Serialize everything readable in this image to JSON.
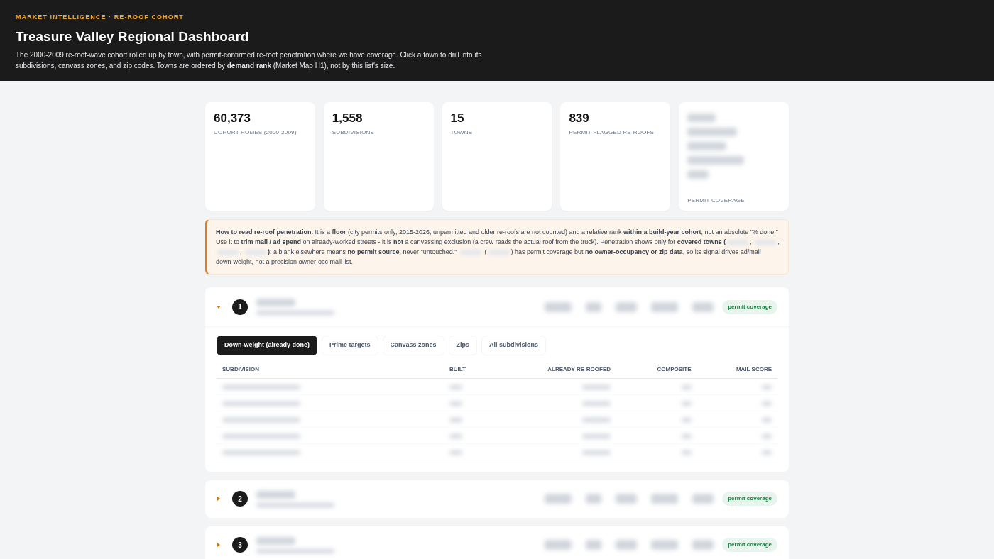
{
  "header": {
    "eyebrow": "MARKET INTELLIGENCE · RE-ROOF COHORT",
    "title": "Treasure Valley Regional Dashboard",
    "description": "The 2000-2009 re-roof-wave cohort rolled up by town, with permit-confirmed re-roof penetration where we have coverage. Click a town to drill into its subdivisions, canvass zones, and zip codes. Towns are ordered by **demand rank** (Market Map H1), not by this list's size."
  },
  "stats": [
    {
      "kind": "value",
      "value": "60,373",
      "label": "COHORT HOMES (2000-2009)"
    },
    {
      "kind": "value",
      "value": "1,558",
      "label": "SUBDIVISIONS"
    },
    {
      "kind": "value",
      "value": "15",
      "label": "TOWNS"
    },
    {
      "kind": "value",
      "value": "839",
      "label": "PERMIT-FLAGGED RE-ROOFS"
    },
    {
      "kind": "redacted",
      "label": "PERMIT COVERAGE"
    }
  ],
  "callout": {
    "parts": [
      {
        "kind": "text",
        "text": "**How to read re-roof penetration.** It is a **floor** (city permits only, 2015-2026; unpermitted and older re-roofs are not counted) and a relative rank **within a build-year cohort**, not an absolute \"% done.\" Use it to **trim mail / ad spend** on already-worked streets - it is **not** a canvassing exclusion (a crew reads the actual roof from the truck). Penetration shows only for **covered towns (**"
      },
      {
        "kind": "redacted"
      },
      {
        "kind": "text",
        "text": ", "
      },
      {
        "kind": "redacted"
      },
      {
        "kind": "text",
        "text": ", "
      },
      {
        "kind": "redacted"
      },
      {
        "kind": "text",
        "text": ", "
      },
      {
        "kind": "redacted"
      },
      {
        "kind": "text",
        "text": "**)**; a blank elsewhere means **no permit source**, never \"untouched.\" "
      },
      {
        "kind": "redacted"
      },
      {
        "kind": "text",
        "text": " ("
      },
      {
        "kind": "redacted"
      },
      {
        "kind": "text",
        "text": ") has permit coverage but **no owner-occupancy or zip data**, so its signal drives ad/mail down-weight, not a precision owner-occ mail list."
      }
    ]
  },
  "towns": [
    {
      "rank": "1",
      "expanded": true,
      "badge": "permit coverage",
      "tabs": [
        {
          "label": "Down-weight (already done)",
          "selected": true
        },
        {
          "label": "Prime targets",
          "selected": false
        },
        {
          "label": "Canvass zones",
          "selected": false
        },
        {
          "label": "Zips",
          "selected": false
        },
        {
          "label": "All subdivisions",
          "selected": false
        }
      ],
      "columns": [
        "SUBDIVISION",
        "BUILT",
        "ALREADY RE-ROOFED",
        "COMPOSITE",
        "MAIL SCORE"
      ],
      "rows": [
        {
          "kind": "redacted"
        },
        {
          "kind": "redacted"
        },
        {
          "kind": "redacted"
        },
        {
          "kind": "redacted"
        },
        {
          "kind": "redacted"
        }
      ]
    },
    {
      "rank": "2",
      "expanded": false,
      "badge": "permit coverage"
    },
    {
      "rank": "3",
      "expanded": false,
      "badge": "permit coverage"
    }
  ]
}
